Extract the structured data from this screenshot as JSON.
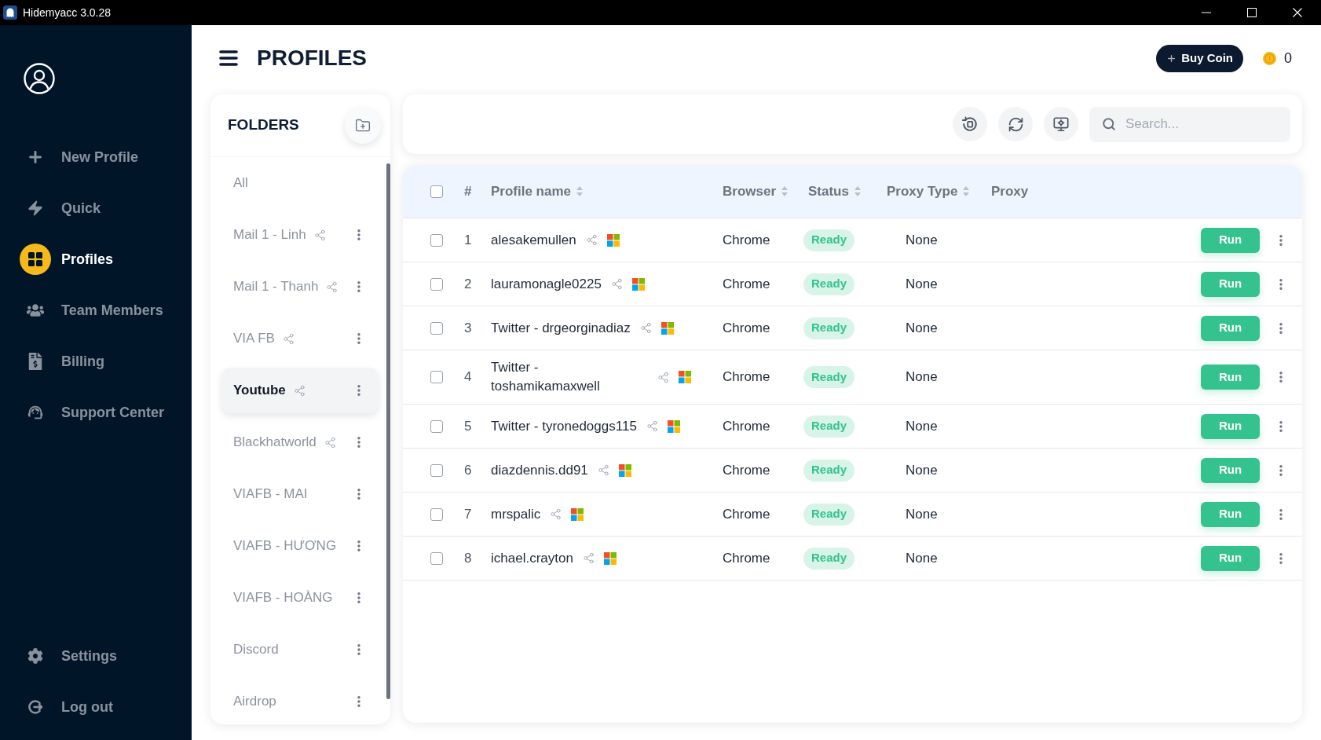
{
  "window": {
    "title": "Hidemyacc 3.0.28"
  },
  "sidebar": {
    "items": [
      {
        "label": "New Profile",
        "selected": false
      },
      {
        "label": "Quick",
        "selected": false
      },
      {
        "label": "Profiles",
        "selected": true
      },
      {
        "label": "Team Members",
        "selected": false
      },
      {
        "label": "Billing",
        "selected": false
      },
      {
        "label": "Support Center",
        "selected": false
      }
    ],
    "bottom_items": [
      {
        "label": "Settings"
      },
      {
        "label": "Log out"
      }
    ]
  },
  "header": {
    "title": "PROFILES",
    "buy_button": "Buy Coin",
    "coin_balance": "0"
  },
  "folders": {
    "title": "FOLDERS",
    "items": [
      {
        "kind": "all",
        "label": "All",
        "selected": false,
        "shared": false
      },
      {
        "kind": "folder",
        "label": "Mail 1 - Linh",
        "selected": false,
        "shared": true
      },
      {
        "kind": "folder",
        "label": "Mail 1 - Thanh",
        "selected": false,
        "shared": true
      },
      {
        "kind": "folder",
        "label": "VIA FB",
        "selected": false,
        "shared": true
      },
      {
        "kind": "folder",
        "label": "Youtube",
        "selected": true,
        "shared": true
      },
      {
        "kind": "folder",
        "label": "Blackhatworld",
        "selected": false,
        "shared": true
      },
      {
        "kind": "folder",
        "label": "VIAFB - MAI",
        "selected": false,
        "shared": false
      },
      {
        "kind": "folder",
        "label": "VIAFB - HƯƠNG",
        "selected": false,
        "shared": false
      },
      {
        "kind": "folder",
        "label": "VIAFB - HOÀNG",
        "selected": false,
        "shared": false
      },
      {
        "kind": "folder",
        "label": "Discord",
        "selected": false,
        "shared": false
      },
      {
        "kind": "folder",
        "label": "Airdrop",
        "selected": false,
        "shared": false
      }
    ]
  },
  "search": {
    "placeholder": "Search..."
  },
  "table": {
    "select_all": {
      "checked": false
    },
    "columns": [
      {
        "label": "#",
        "sortable": false
      },
      {
        "label": "Profile name",
        "sortable": true
      },
      {
        "label": "Browser",
        "sortable": true
      },
      {
        "label": "Status",
        "sortable": true
      },
      {
        "label": "Proxy Type",
        "sortable": true
      },
      {
        "label": "Proxy",
        "sortable": false
      }
    ],
    "rows": [
      {
        "checked": false,
        "number": "1",
        "name": "alesakemullen",
        "shared": true,
        "browser": "Chrome",
        "status": "Ready",
        "proxy_type": "None",
        "action": "Run"
      },
      {
        "checked": false,
        "number": "2",
        "name": "lauramonagle0225",
        "shared": true,
        "browser": "Chrome",
        "status": "Ready",
        "proxy_type": "None",
        "action": "Run"
      },
      {
        "checked": false,
        "number": "3",
        "name": "Twitter - drgeorginadiaz",
        "shared": true,
        "browser": "Chrome",
        "status": "Ready",
        "proxy_type": "None",
        "action": "Run"
      },
      {
        "checked": false,
        "number": "4",
        "name": "Twitter - toshamikamaxwell",
        "shared": true,
        "browser": "Chrome",
        "status": "Ready",
        "proxy_type": "None",
        "action": "Run"
      },
      {
        "checked": false,
        "number": "5",
        "name": "Twitter - tyronedoggs115",
        "shared": true,
        "browser": "Chrome",
        "status": "Ready",
        "proxy_type": "None",
        "action": "Run"
      },
      {
        "checked": false,
        "number": "6",
        "name": "diazdennis.dd91",
        "shared": true,
        "browser": "Chrome",
        "status": "Ready",
        "proxy_type": "None",
        "action": "Run"
      },
      {
        "checked": false,
        "number": "7",
        "name": "mrspalic",
        "shared": true,
        "browser": "Chrome",
        "status": "Ready",
        "proxy_type": "None",
        "action": "Run"
      },
      {
        "checked": false,
        "number": "8",
        "name": "ichael.crayton",
        "shared": true,
        "browser": "Chrome",
        "status": "Ready",
        "proxy_type": "None",
        "action": "Run"
      }
    ]
  }
}
